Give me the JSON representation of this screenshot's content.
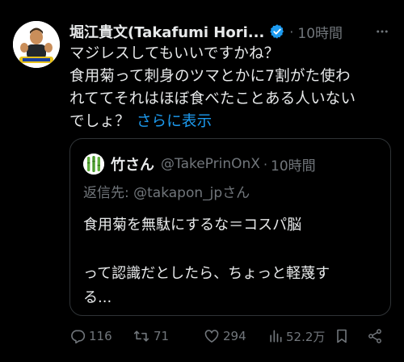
{
  "author": {
    "display_name": "堀江貴文(Takafumi Hori...",
    "time": "10時間",
    "separator": "·"
  },
  "post": {
    "lines": [
      "マジレスしてもいいですかね？",
      "食用菊って刺身のツマとかに7割がた使わ",
      "れててそれはほぼ食べたことある人いない",
      "でしょ？"
    ],
    "show_more": "さらに表示"
  },
  "quote": {
    "name": "竹さん",
    "handle": "@TakePrinOnX",
    "separator": "·",
    "time": "10時間",
    "reply_prefix": "返信先: ",
    "reply_handle": "@takapon_jp",
    "reply_suffix": "さん",
    "lines": [
      "食用菊を無駄にするな＝コスパ脳",
      "",
      "って認識だとしたら、ちょっと軽蔑す",
      "る..."
    ]
  },
  "actions": {
    "replies": "116",
    "reposts": "71",
    "likes": "294",
    "views": "52.2万"
  },
  "icons": {
    "verified": "verified-badge-icon",
    "more": "more-options-icon",
    "reply": "reply-icon",
    "repost": "repost-icon",
    "like": "heart-icon",
    "views": "analytics-icon",
    "bookmark": "bookmark-icon",
    "share": "share-icon"
  },
  "colors": {
    "background": "#000000",
    "text": "#e7e9ea",
    "secondary": "#71767b",
    "link": "#1d9bf0",
    "border": "#2f3336",
    "verified": "#1d9bf0"
  }
}
